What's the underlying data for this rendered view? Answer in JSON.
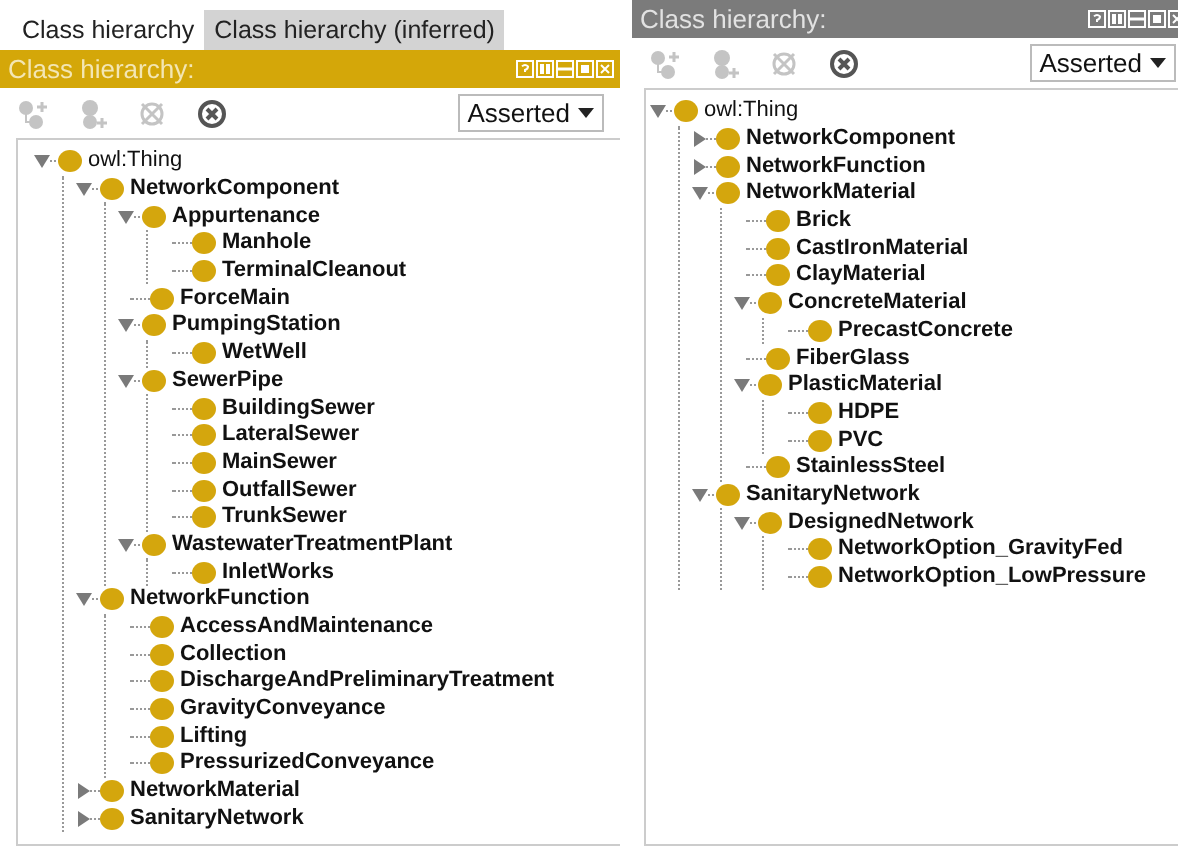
{
  "panels": [
    {
      "tabs": [
        {
          "label": "Class hierarchy",
          "selected": true
        },
        {
          "label": "Class hierarchy (inferred)",
          "selected": false
        }
      ],
      "header": {
        "title": "Class hierarchy:",
        "active": true
      },
      "toolbar": [
        {
          "kind": "add-subclass",
          "disabled": true
        },
        {
          "kind": "add-sibling",
          "disabled": true
        },
        {
          "kind": "delete",
          "disabled": true
        },
        {
          "kind": "clear",
          "disabled": false
        }
      ],
      "view": "Asserted",
      "tree": [
        {
          "label": "owl:Thing",
          "expanded": true,
          "children": [
            {
              "label": "NetworkComponent",
              "expanded": true,
              "children": [
                {
                  "label": "Appurtenance",
                  "expanded": true,
                  "children": [
                    {
                      "label": "Manhole"
                    },
                    {
                      "label": "TerminalCleanout"
                    }
                  ]
                },
                {
                  "label": "ForceMain"
                },
                {
                  "label": "PumpingStation",
                  "expanded": true,
                  "children": [
                    {
                      "label": "WetWell"
                    }
                  ]
                },
                {
                  "label": "SewerPipe",
                  "expanded": true,
                  "children": [
                    {
                      "label": "BuildingSewer"
                    },
                    {
                      "label": "LateralSewer"
                    },
                    {
                      "label": "MainSewer"
                    },
                    {
                      "label": "OutfallSewer"
                    },
                    {
                      "label": "TrunkSewer"
                    }
                  ]
                },
                {
                  "label": "WastewaterTreatmentPlant",
                  "expanded": true,
                  "children": [
                    {
                      "label": "InletWorks"
                    }
                  ]
                }
              ]
            },
            {
              "label": "NetworkFunction",
              "expanded": true,
              "children": [
                {
                  "label": "AccessAndMaintenance"
                },
                {
                  "label": "Collection"
                },
                {
                  "label": "DischargeAndPreliminaryTreatment"
                },
                {
                  "label": "GravityConveyance"
                },
                {
                  "label": "Lifting"
                },
                {
                  "label": "PressurizedConveyance"
                }
              ]
            },
            {
              "label": "NetworkMaterial",
              "expanded": false
            },
            {
              "label": "SanitaryNetwork",
              "expanded": false
            }
          ]
        }
      ]
    },
    {
      "header": {
        "title": "Class hierarchy:",
        "active": false
      },
      "toolbar": [
        {
          "kind": "add-subclass",
          "disabled": true
        },
        {
          "kind": "add-sibling",
          "disabled": true
        },
        {
          "kind": "delete",
          "disabled": true
        },
        {
          "kind": "clear",
          "disabled": false
        }
      ],
      "view": "Asserted",
      "tree": [
        {
          "label": "owl:Thing",
          "expanded": true,
          "children": [
            {
              "label": "NetworkComponent",
              "expanded": false
            },
            {
              "label": "NetworkFunction",
              "expanded": false
            },
            {
              "label": "NetworkMaterial",
              "expanded": true,
              "children": [
                {
                  "label": "Brick"
                },
                {
                  "label": "CastIronMaterial"
                },
                {
                  "label": "ClayMaterial"
                },
                {
                  "label": "ConcreteMaterial",
                  "expanded": true,
                  "children": [
                    {
                      "label": "PrecastConcrete"
                    }
                  ]
                },
                {
                  "label": "FiberGlass"
                },
                {
                  "label": "PlasticMaterial",
                  "expanded": true,
                  "children": [
                    {
                      "label": "HDPE"
                    },
                    {
                      "label": "PVC"
                    }
                  ]
                },
                {
                  "label": "StainlessSteel"
                }
              ]
            },
            {
              "label": "SanitaryNetwork",
              "expanded": true,
              "children": [
                {
                  "label": "DesignedNetwork",
                  "expanded": true,
                  "children": [
                    {
                      "label": "NetworkOption_GravityFed"
                    },
                    {
                      "label": "NetworkOption_LowPressure"
                    }
                  ]
                }
              ]
            }
          ]
        }
      ]
    }
  ]
}
